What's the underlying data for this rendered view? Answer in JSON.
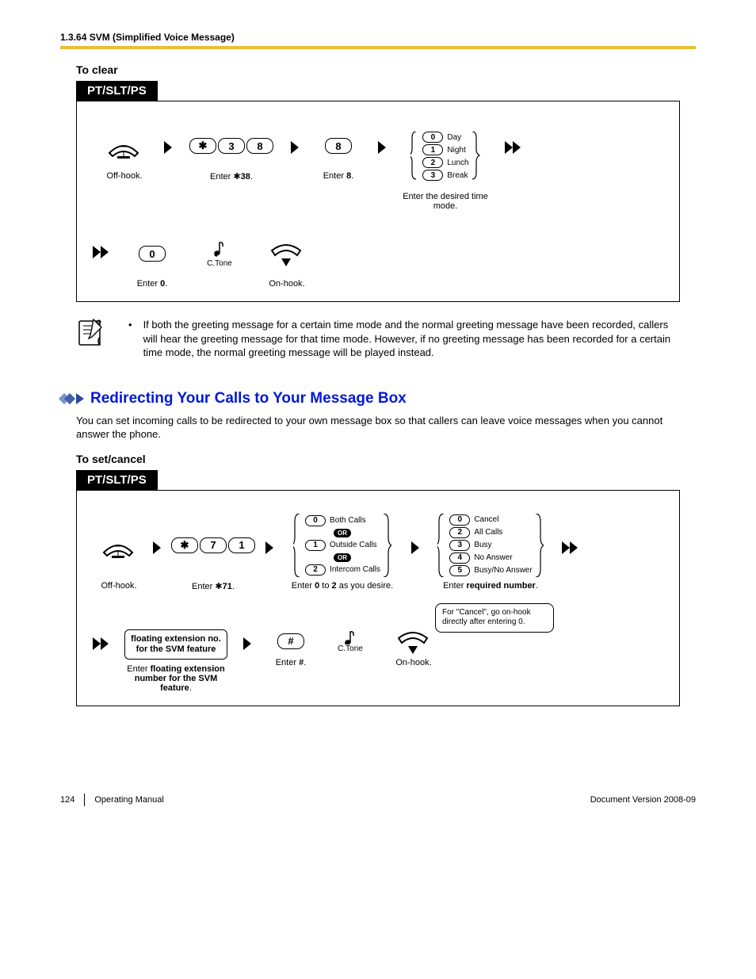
{
  "header": {
    "section": "1.3.64 SVM (Simplified Voice Message)"
  },
  "proc1": {
    "heading": "To clear",
    "tab": "PT/SLT/PS",
    "step1": "Off-hook.",
    "step2_keys": [
      "*",
      "3",
      "8"
    ],
    "step2_label_a": "Enter ",
    "step2_label_b": "38",
    "step2_label_c": ".",
    "step3_label_a": "Enter ",
    "step3_label_b": "8",
    "step3_label_c": ".",
    "timemode_opts": [
      {
        "k": "0",
        "t": "Day"
      },
      {
        "k": "1",
        "t": "Night"
      },
      {
        "k": "2",
        "t": "Lunch"
      },
      {
        "k": "3",
        "t": "Break"
      }
    ],
    "timemode_label": "Enter the desired time mode.",
    "row2_step1_label_a": "Enter ",
    "row2_step1_label_b": "0",
    "row2_step1_label_c": ".",
    "ctone": "C.Tone",
    "onhook": "On-hook."
  },
  "note": {
    "text": "If both the greeting message for a certain time mode and the normal greeting message have been recorded, callers will hear the greeting message for that time mode. However, if no greeting message has been recorded for a certain time mode, the normal greeting message will be played instead."
  },
  "section2": {
    "title": "Redirecting Your Calls to Your Message Box",
    "intro": "You can set incoming calls to be redirected to your own message box so that callers can leave voice messages when you cannot answer the phone.",
    "heading": "To set/cancel",
    "tab": "PT/SLT/PS",
    "step1": "Off-hook.",
    "step2_keys": [
      "*",
      "7",
      "1"
    ],
    "step2_label_a": "Enter ",
    "step2_label_b": "71",
    "step2_label_c": ".",
    "call_opts": [
      {
        "k": "0",
        "t": "Both Calls"
      },
      {
        "k": "1",
        "t": "Outside Calls"
      },
      {
        "k": "2",
        "t": "Intercom Calls"
      }
    ],
    "call_label_a": "Enter ",
    "call_label_b": "0",
    "call_label_c": " to ",
    "call_label_d": "2",
    "call_label_e": " as you desire.",
    "req_opts": [
      {
        "k": "0",
        "t": "Cancel"
      },
      {
        "k": "2",
        "t": "All Calls"
      },
      {
        "k": "3",
        "t": "Busy"
      },
      {
        "k": "4",
        "t": "No Answer"
      },
      {
        "k": "5",
        "t": "Busy/No Answer"
      }
    ],
    "req_label_a": "Enter ",
    "req_label_b": "required number",
    "req_label_c": ".",
    "callout": "For \"Cancel\", go on-hook directly after entering 0.",
    "float_a": "floating extension no.",
    "float_b": "for the SVM feature",
    "float_label_a": "Enter ",
    "float_label_b": "floating extension number for the SVM feature",
    "float_label_c": ".",
    "hash_label_a": "Enter ",
    "hash_label_b": "#",
    "hash_label_c": ".",
    "ctone": "C.Tone",
    "onhook": "On-hook."
  },
  "footer": {
    "page": "124",
    "title": "Operating Manual",
    "version_a": "Document Version  ",
    "version_b": "2008-09"
  }
}
